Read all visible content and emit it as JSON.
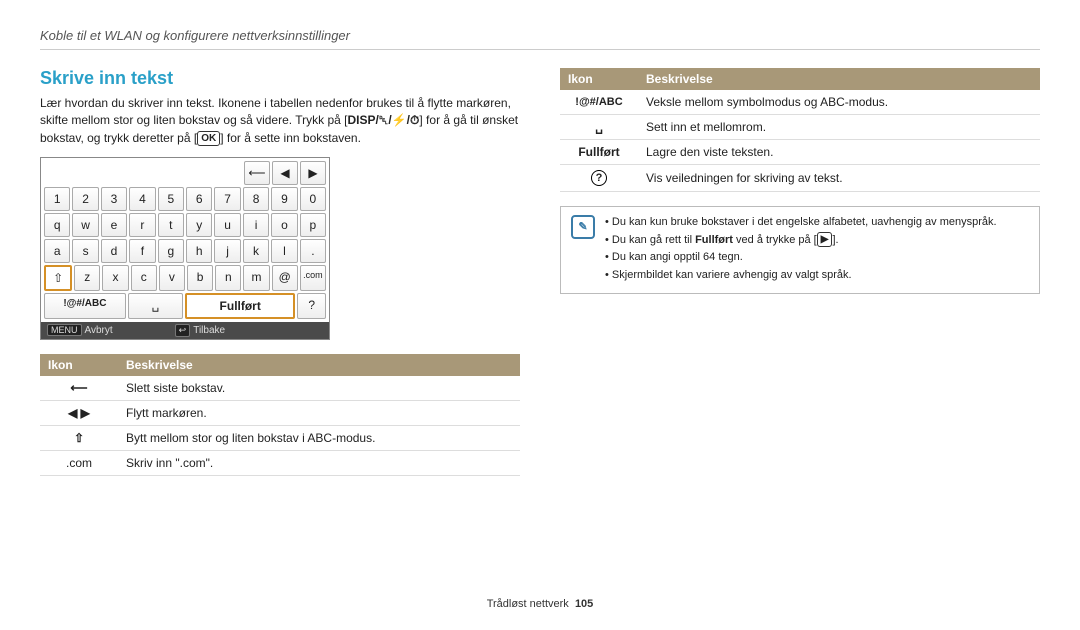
{
  "header": {
    "breadcrumb": "Koble til et WLAN og konfigurere nettverksinnstillinger"
  },
  "section": {
    "title": "Skrive inn tekst",
    "intro_part1": "Lær hvordan du skriver inn tekst. Ikonene i tabellen nedenfor brukes til å flytte markøren, skifte mellom stor og liten bokstav og så videre. Trykk på [",
    "intro_buttons": "DISP/␡/⚡/⏱",
    "intro_part2": "] for å gå til ønsket bokstav, og trykk deretter på [",
    "intro_ok": "OK",
    "intro_part3": "] for å sette inn bokstaven."
  },
  "keyboard": {
    "top": [
      "⟵",
      "◀",
      "▶"
    ],
    "row1": [
      "1",
      "2",
      "3",
      "4",
      "5",
      "6",
      "7",
      "8",
      "9",
      "0"
    ],
    "row2": [
      "q",
      "w",
      "e",
      "r",
      "t",
      "y",
      "u",
      "i",
      "o",
      "p"
    ],
    "row3": [
      "a",
      "s",
      "d",
      "f",
      "g",
      "h",
      "j",
      "k",
      "l",
      "."
    ],
    "row4": [
      "⇧",
      "z",
      "x",
      "c",
      "v",
      "b",
      "n",
      "m",
      "@",
      ".com"
    ],
    "row5": [
      "!@#/ABC",
      "␣",
      "Fullført",
      "?"
    ],
    "footer_left_tag": "MENU",
    "footer_left": "Avbryt",
    "footer_right_tag": "↩",
    "footer_right": "Tilbake"
  },
  "table_headers": {
    "icon": "Ikon",
    "desc": "Beskrivelse"
  },
  "left_rows": [
    {
      "icon": "⟵",
      "desc": "Slett siste bokstav."
    },
    {
      "icon": "◀  ▶",
      "desc": "Flytt markøren."
    },
    {
      "icon": "⇧",
      "desc": "Bytt mellom stor og liten bokstav i ABC-modus."
    },
    {
      "icon": ".com",
      "desc": "Skriv inn \".com\"."
    }
  ],
  "right_rows": [
    {
      "icon": "!@#/ABC",
      "desc": "Veksle mellom symbolmodus og ABC-modus."
    },
    {
      "icon": "␣",
      "desc": "Sett inn et mellomrom."
    },
    {
      "icon": "Fullført",
      "bold": true,
      "desc": "Lagre den viste teksten."
    },
    {
      "icon": "?",
      "circled": true,
      "desc": "Vis veiledningen for skriving av tekst."
    }
  ],
  "notes": {
    "items": [
      "Du kan kun bruke bokstaver i det engelske alfabetet, uavhengig av menyspråk.",
      "Du kan gå rett til Fullført ved å trykke på [▶].",
      "Du kan angi opptil 64 tegn.",
      "Skjermbildet kan variere avhengig av valgt språk."
    ]
  },
  "footer": {
    "section": "Trådløst nettverk",
    "page": "105"
  }
}
